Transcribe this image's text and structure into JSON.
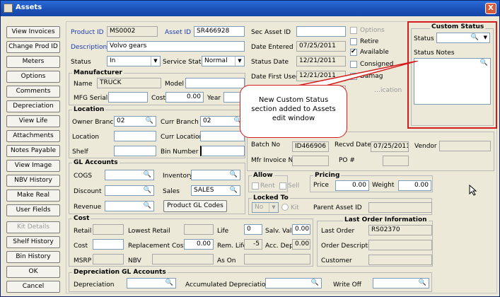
{
  "window": {
    "title": "Assets",
    "close": "X"
  },
  "left_buttons": [
    "View Invoices",
    "Change Prod ID",
    "Meters",
    "Options",
    "Comments",
    "Depreciation",
    "View Life",
    "Attachments",
    "Notes Payable",
    "View Image",
    "NBV History",
    "Make Real",
    "User Fields",
    "Kit Details",
    "Shelf History",
    "Bin History",
    "OK",
    "Cancel"
  ],
  "top": {
    "product_id_label": "Product ID",
    "product_id": "MS0002",
    "asset_id_label": "Asset ID",
    "asset_id": "SR466928",
    "description_label": "Description",
    "description": "Volvo gears",
    "status_label": "Status",
    "status": "In",
    "service_status_label": "Service Status",
    "service_status": "Normal"
  },
  "manufacturer": {
    "title": "Manufacturer",
    "name_label": "Name",
    "name": "TRUCK",
    "model_label": "Model",
    "model": "",
    "serial_label": "MFG Serial#",
    "serial": "",
    "cost_label": "Cost",
    "cost": "0.00",
    "year_label": "Year",
    "year": ""
  },
  "location": {
    "title": "Location",
    "owner_branch_label": "Owner Branch",
    "owner_branch": "02",
    "curr_branch_label": "Curr Branch",
    "curr_branch": "02",
    "location_label": "Location",
    "curr_location_label": "Curr Location",
    "shelf_label": "Shelf",
    "bin_label": "Bin Number"
  },
  "gl": {
    "title": "GL Accounts",
    "cogs_label": "COGS",
    "inventory_label": "Inventory",
    "discount_label": "Discount",
    "sales_label": "Sales",
    "sales": "SALES",
    "revenue_label": "Revenue",
    "product_gl_button": "Product GL Codes"
  },
  "dates": {
    "sec_asset_label": "Sec Asset ID",
    "date_entered_label": "Date Entered",
    "date_entered": "07/25/2011",
    "status_date_label": "Status Date",
    "status_date": "12/21/2011",
    "date_first_used_label": "Date First Used",
    "date_first_used": "12/21/2011"
  },
  "checks": {
    "options": "Options",
    "retire": "Retire",
    "available": "Available",
    "consigned": "Consigned",
    "damaged": "Damag",
    "obscured_label": "…ication"
  },
  "custom_status": {
    "title": "Custom Status",
    "status_label": "Status",
    "notes_label": "Status Notes"
  },
  "callout": {
    "text": "New Custom Status section added to Assets edit window"
  },
  "batch": {
    "batch_label": "Batch No",
    "batch": "ID466906",
    "recvd_label": "Recvd Date",
    "recvd": "07/25/2011",
    "vendor_label": "Vendor",
    "mfr_invoice_label": "Mfr Invoice No",
    "po_label": "PO #"
  },
  "allow": {
    "title": "Allow",
    "rent": "Rent",
    "sell": "Sell"
  },
  "pricing": {
    "title": "Pricing",
    "price_label": "Price",
    "price": "0.00",
    "weight_label": "Weight",
    "weight": "0.00"
  },
  "locked": {
    "title": "Locked To",
    "value": "No",
    "kit_label": "Kit",
    "parent_label": "Parent Asset ID"
  },
  "cost": {
    "title": "Cost",
    "retail_label": "Retail",
    "lowest_retail_label": "Lowest Retail",
    "life_label": "Life",
    "life": "0",
    "salv_label": "Salv. Val",
    "salv": "0.00",
    "cost_label": "Cost",
    "replacement_label": "Replacement Cost",
    "replacement": "0.00",
    "rem_life_label": "Rem. Life",
    "rem_life": "-5",
    "acc_dep_label": "Acc. Dep",
    "acc_dep": "0.00",
    "msrp_label": "MSRP",
    "nbv_label": "NBV",
    "as_on_label": "As On"
  },
  "last_order": {
    "title": "Last Order Information",
    "last_order_label": "Last Order",
    "last_order": "RS02370",
    "desc_label": "Order Description",
    "customer_label": "Customer"
  },
  "dep_gl": {
    "title": "Depreciation GL Accounts",
    "dep_label": "Depreciation",
    "acc_dep_label": "Accumulated Depreciation",
    "write_off_label": "Write Off"
  },
  "colors": {
    "title_bar": "#1a4fb5",
    "highlight": "#d41c1c",
    "label_blue": "#1a3ab8"
  }
}
